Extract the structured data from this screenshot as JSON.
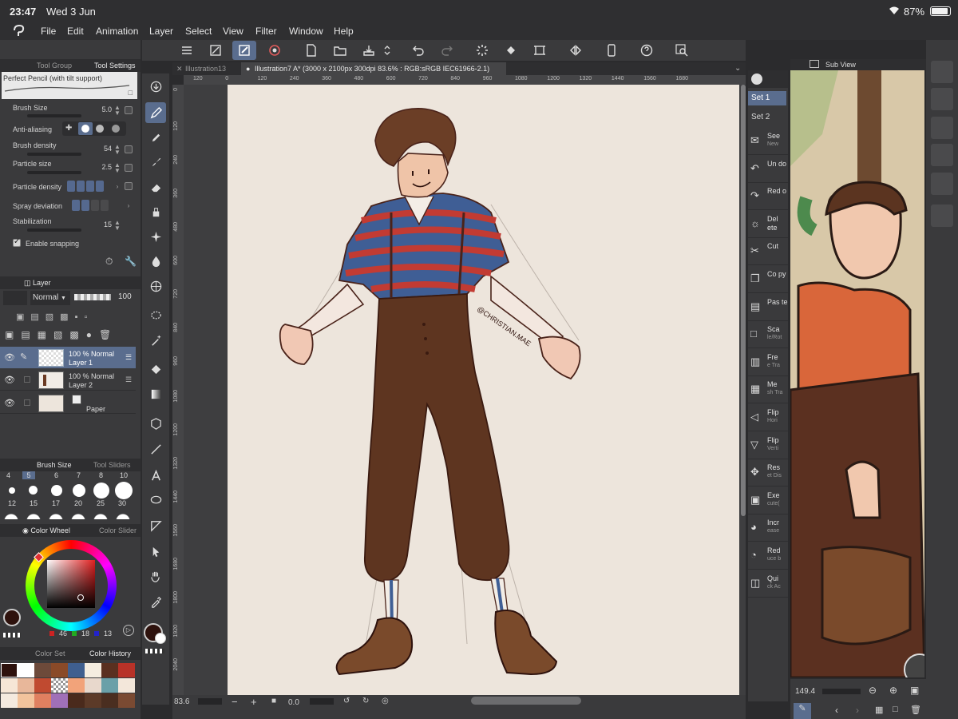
{
  "status": {
    "time": "23:47",
    "date": "Wed 3 Jun",
    "battery": "87%"
  },
  "menu": [
    "File",
    "Edit",
    "Animation",
    "Layer",
    "Select",
    "View",
    "Filter",
    "Window",
    "Help"
  ],
  "tool_panel": {
    "tabs": [
      "Tool Group",
      "Tool Settings"
    ],
    "brush_name": "Perfect Pencil (with tilt support)",
    "brush_size_label": "Brush Size",
    "brush_size": "5.0",
    "anti_aliasing_label": "Anti-aliasing",
    "brush_density_label": "Brush density",
    "brush_density": "54",
    "particle_size_label": "Particle size",
    "particle_size": "2.5",
    "particle_density_label": "Particle density",
    "spray_deviation_label": "Spray deviation",
    "stabilization_label": "Stabilization",
    "stabilization": "15",
    "enable_snapping_label": "Enable snapping"
  },
  "layer_panel": {
    "tab": "Layer",
    "blend_mode": "Normal",
    "opacity": "100",
    "layers": [
      {
        "opacity_mode": "100 % Normal",
        "name": "Layer 1"
      },
      {
        "opacity_mode": "100 % Normal",
        "name": "Layer 2"
      },
      {
        "name": "Paper"
      }
    ]
  },
  "brush_size_panel": {
    "tabs": [
      "Brush Size",
      "Tool Sliders"
    ],
    "sizes_row1": [
      "4",
      "5",
      "6",
      "7",
      "8",
      "10"
    ],
    "sizes_row2": [
      "12",
      "15",
      "17",
      "20",
      "25",
      "30"
    ]
  },
  "color_panel": {
    "tabs": [
      "Color Wheel",
      "Color Slider"
    ],
    "r": "46",
    "g": "18",
    "b": "13",
    "main_color": "#2e120d"
  },
  "color_set_panel": {
    "tabs": [
      "Color Set",
      "Color History"
    ]
  },
  "documents": [
    {
      "title": "Illustration13"
    },
    {
      "title": "Illustration7 A* (3000 x 2100px 300dpi 83.6% : RGB:sRGB IEC61966-2.1)"
    }
  ],
  "ruler_top": [
    "120",
    "0",
    "120",
    "240",
    "360",
    "480",
    "600",
    "720",
    "840",
    "960",
    "1080",
    "1200",
    "1320",
    "1440",
    "1560",
    "1680"
  ],
  "ruler_left": [
    "0",
    "120",
    "240",
    "360",
    "480",
    "600",
    "720",
    "840",
    "960",
    "1080",
    "1200",
    "1320",
    "1440",
    "1560",
    "1680",
    "1800",
    "1920",
    "2040"
  ],
  "bottom": {
    "zoom": "83.6",
    "angle": "0.0"
  },
  "signature": "@CHRISTIAN.MAE",
  "auto_actions": {
    "sets": [
      "Set 1",
      "Set 2"
    ],
    "items": [
      {
        "label": "See",
        "sub": "New",
        "icon": "new-icon"
      },
      {
        "label": "Un do",
        "sub": "",
        "icon": "undo-icon"
      },
      {
        "label": "Red o",
        "sub": "",
        "icon": "redo-icon"
      },
      {
        "label": "Del ete",
        "sub": "",
        "icon": "delete-icon"
      },
      {
        "label": "Cut",
        "sub": "",
        "icon": "scissors-icon"
      },
      {
        "label": "Co py",
        "sub": "",
        "icon": "copy-icon"
      },
      {
        "label": "Pas te",
        "sub": "",
        "icon": "paste-icon"
      },
      {
        "label": "Sca",
        "sub": "le/Rot",
        "icon": "scale-icon"
      },
      {
        "label": "Fre",
        "sub": "e Tra",
        "icon": "free-transform-icon"
      },
      {
        "label": "Me",
        "sub": "sh Tra",
        "icon": "mesh-icon"
      },
      {
        "label": "Flip",
        "sub": "Hori",
        "icon": "flip-horizontal-icon"
      },
      {
        "label": "Flip",
        "sub": "Verti",
        "icon": "flip-vertical-icon"
      },
      {
        "label": "Res",
        "sub": "et Dis",
        "icon": "reset-display-icon"
      },
      {
        "label": "Exe",
        "sub": "cute(",
        "icon": "execute-icon"
      },
      {
        "label": "Incr",
        "sub": "ease",
        "icon": "increase-icon"
      },
      {
        "label": "Red",
        "sub": "uce b",
        "icon": "reduce-icon"
      },
      {
        "label": "Qui",
        "sub": "ck Ac",
        "icon": "quick-access-icon"
      }
    ]
  },
  "sub_view": {
    "tab": "Sub View",
    "zoom": "149.4"
  },
  "colors": {
    "accent": "#5a6d8e",
    "panel": "#3a3a3c",
    "canvas_bg": "#ede5dc"
  }
}
